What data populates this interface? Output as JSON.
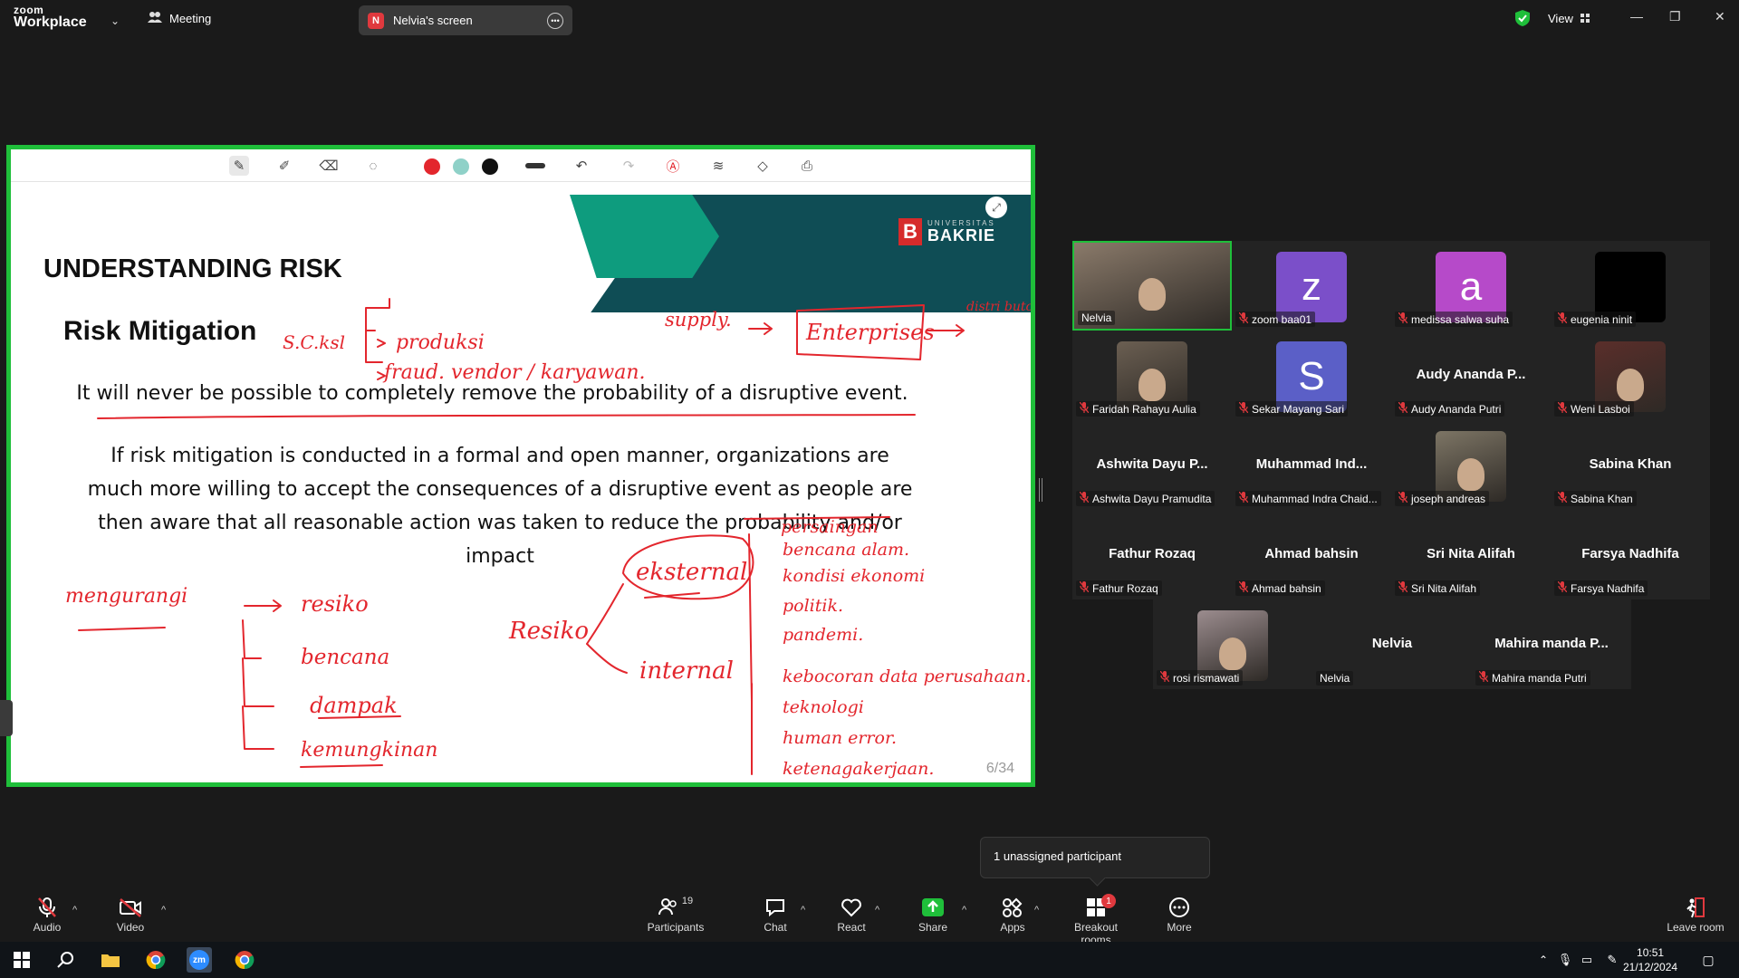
{
  "app": {
    "brand_small": "zoom",
    "brand": "Workplace",
    "meeting_label": "Meeting",
    "view_label": "View"
  },
  "share_tab": {
    "initial": "N",
    "label": "Nelvia's screen"
  },
  "slide": {
    "logo_small": "UNIVERSITAS",
    "logo_big": "BAKRIE",
    "title": "UNDERSTANDING RISK",
    "subtitle": "Risk Mitigation",
    "para1": "It will never be possible to completely remove the probability of a disruptive event.",
    "para2": "If risk mitigation is conducted in a formal and open manner, organizations are much more willing to accept the consequences of a disruptive event as people are then aware that all reasonable action was taken to reduce the probability and/or impact",
    "page": "6/34"
  },
  "ink_text": {
    "sc": "S.C.ksl",
    "produksi": "produksi",
    "vendor": "fraud. vendor / karyawan.",
    "supply": "supply.",
    "enterprises": "Enterprises",
    "distributor": "distri butor",
    "mengurangi": "mengurangi",
    "resiko1": "resiko",
    "bencana": "bencana",
    "dampak": "dampak",
    "kemungkinan": "kemungkinan",
    "resiko2": "Resiko",
    "eksternal": "eksternal",
    "internal": "internal",
    "bencana_alam": "bencana alam.",
    "kondisi": "kondisi ekonomi",
    "politik": "politik.",
    "pandemi": "pandemi.",
    "kebocoran": "kebocoran data perusahaan.",
    "teknologi": "teknologi",
    "human": "human error.",
    "ketenagakerjaan": "ketenagakerjaan.",
    "pasar": "persaingan"
  },
  "participants": [
    {
      "name": "Nelvia",
      "kind": "photo",
      "color": "#8a7a6a",
      "highlight": true,
      "muted": false
    },
    {
      "name": "zoom baa01",
      "kind": "letter",
      "letter": "z",
      "color": "#7b4fc9",
      "muted": true
    },
    {
      "name": "medissa salwa suha",
      "kind": "letter",
      "letter": "a",
      "color": "#b64ac9",
      "muted": true
    },
    {
      "name": "eugenia ninit",
      "kind": "black",
      "color": "#000000",
      "muted": true
    },
    {
      "name": "Faridah Rahayu Aulia",
      "kind": "photo",
      "color": "#6b5f52",
      "muted": true
    },
    {
      "name": "Sekar Mayang Sari",
      "kind": "letter",
      "letter": "S",
      "color": "#5b5fc7",
      "muted": true
    },
    {
      "name": "Audy Ananda Putri",
      "kind": "text",
      "bigname": "Audy Ananda P...",
      "muted": true
    },
    {
      "name": "Weni Lasboi",
      "kind": "photo",
      "color": "#5a2e2a",
      "muted": true
    },
    {
      "name": "Ashwita Dayu Pramudita",
      "kind": "text",
      "bigname": "Ashwita Dayu P...",
      "muted": true
    },
    {
      "name": "Muhammad Indra Chaid...",
      "kind": "text",
      "bigname": "Muhammad  Ind...",
      "muted": true
    },
    {
      "name": "joseph andreas",
      "kind": "photo",
      "color": "#7d7565",
      "muted": true
    },
    {
      "name": "Sabina Khan",
      "kind": "text",
      "bigname": "Sabina Khan",
      "muted": true
    },
    {
      "name": "Fathur Rozaq",
      "kind": "text",
      "bigname": "Fathur Rozaq",
      "muted": true
    },
    {
      "name": "Ahmad bahsin",
      "kind": "text",
      "bigname": "Ahmad bahsin",
      "muted": true
    },
    {
      "name": "Sri Nita Alifah",
      "kind": "text",
      "bigname": "Sri Nita Alifah",
      "muted": true
    },
    {
      "name": "Farsya Nadhifa",
      "kind": "text",
      "bigname": "Farsya Nadhifa",
      "muted": true
    },
    {
      "name": "rosi rismawati",
      "kind": "photo",
      "color": "#9b8c8e",
      "muted": true
    },
    {
      "name": "Nelvia",
      "kind": "text",
      "bigname": "Nelvia",
      "muted": false
    },
    {
      "name": "Mahira manda Putri",
      "kind": "text",
      "bigname": "Mahira manda P...",
      "muted": true
    }
  ],
  "popup": {
    "text": "1 unassigned participant"
  },
  "controls": {
    "audio": "Audio",
    "video": "Video",
    "participants": "Participants",
    "participants_count": "19",
    "chat": "Chat",
    "react": "React",
    "share": "Share",
    "apps": "Apps",
    "breakout": "Breakout rooms",
    "breakout_badge": "1",
    "more": "More",
    "leave": "Leave room"
  },
  "taskbar": {
    "time": "10:51",
    "date": "21/12/2024"
  },
  "colors": {
    "accent_green": "#1fbf3a",
    "ink_red": "#e3262d",
    "muted_red": "#e0393e"
  }
}
